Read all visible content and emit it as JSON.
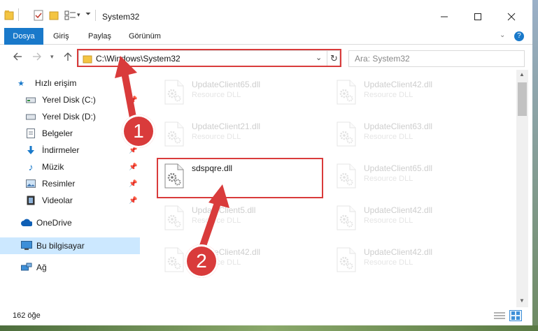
{
  "window": {
    "title": "System32"
  },
  "ribbon": {
    "tabs": [
      "Dosya",
      "Giriş",
      "Paylaş",
      "Görünüm"
    ]
  },
  "address": {
    "path": "C:\\Windows\\System32",
    "search_placeholder": "Ara: System32"
  },
  "sidebar": {
    "items": [
      {
        "label": "Hızlı erişim",
        "icon": "star-icon",
        "pinned": false
      },
      {
        "label": "Yerel Disk (C:)",
        "icon": "drive-icon",
        "pinned": true
      },
      {
        "label": "Yerel Disk (D:)",
        "icon": "drive-icon",
        "pinned": false
      },
      {
        "label": "Belgeler",
        "icon": "document-icon",
        "pinned": true
      },
      {
        "label": "İndirmeler",
        "icon": "download-icon",
        "pinned": true
      },
      {
        "label": "Müzik",
        "icon": "music-icon",
        "pinned": true
      },
      {
        "label": "Resimler",
        "icon": "picture-icon",
        "pinned": true
      },
      {
        "label": "Videolar",
        "icon": "video-icon",
        "pinned": true
      },
      {
        "label": "OneDrive",
        "icon": "cloud-icon",
        "pinned": false
      },
      {
        "label": "Bu bilgisayar",
        "icon": "computer-icon",
        "pinned": false
      },
      {
        "label": "Ağ",
        "icon": "network-icon",
        "pinned": false
      }
    ]
  },
  "files": [
    {
      "name": "UpdateClient65.dll",
      "type": "Resource DLL",
      "faded": true
    },
    {
      "name": "UpdateClient42.dll",
      "type": "Resource DLL",
      "faded": true
    },
    {
      "name": "UpdateClient21.dll",
      "type": "Resource DLL",
      "faded": true
    },
    {
      "name": "UpdateClient63.dll",
      "type": "Resource DLL",
      "faded": true
    },
    {
      "name": "sdspqre.dll",
      "type": "",
      "faded": false
    },
    {
      "name": "UpdateClient65.dll",
      "type": "Resource DLL",
      "faded": true
    },
    {
      "name": "UpdateClient5.dll",
      "type": "Resource DLL",
      "faded": true
    },
    {
      "name": "UpdateClient42.dll",
      "type": "Resource DLL",
      "faded": true
    },
    {
      "name": "UpdateClient42.dll",
      "type": "Resource DLL",
      "faded": true
    },
    {
      "name": "UpdateClient42.dll",
      "type": "Resource DLL",
      "faded": true
    }
  ],
  "status": {
    "count": "162 öğe"
  },
  "annotations": {
    "step1": "1",
    "step2": "2"
  },
  "colors": {
    "accent": "#1979ca",
    "highlight": "#d93b3b",
    "selection": "#cce8ff"
  }
}
